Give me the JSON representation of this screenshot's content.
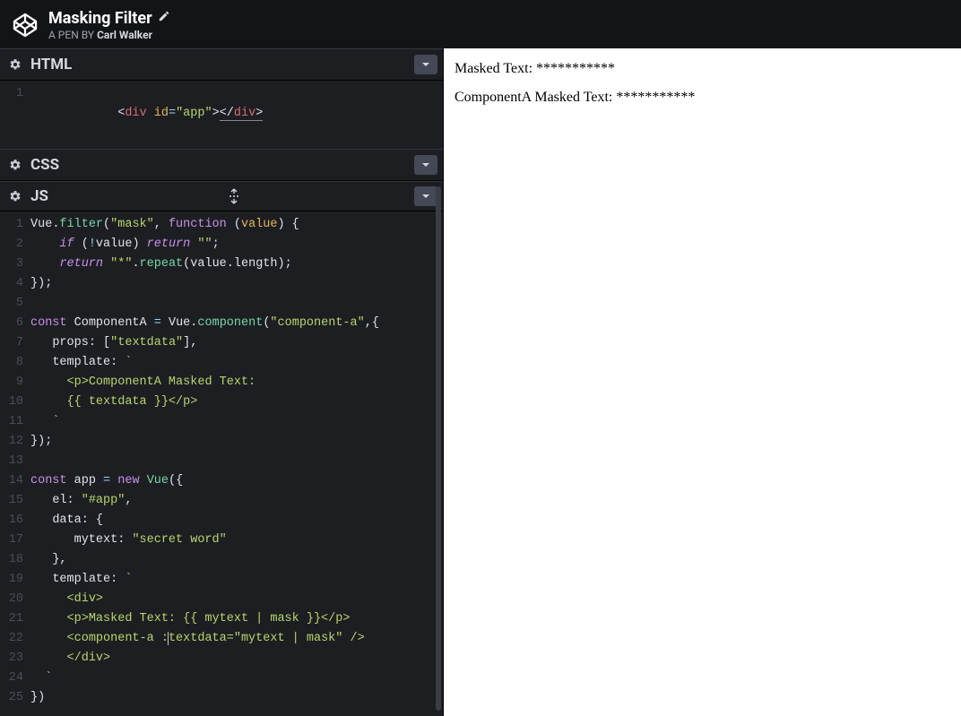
{
  "header": {
    "title": "Masking Filter",
    "byline_prefix": "A PEN BY ",
    "author": "Carl Walker"
  },
  "panels": {
    "html": {
      "label": "HTML"
    },
    "css": {
      "label": "CSS"
    },
    "js": {
      "label": "JS"
    }
  },
  "icons": {
    "gear": "gear-icon",
    "chevron": "chevron-down-icon",
    "resize": "resize-vertical-icon",
    "pencil": "pencil-icon",
    "logo": "codepen-logo"
  },
  "html_code": {
    "l1": {
      "num": "1",
      "a": "<",
      "tag": "div",
      "sp": " ",
      "attr": "id",
      "eq": "=",
      "val": "\"app\"",
      "b": ">",
      "c": "<",
      "slash": "/",
      "tag2": "div",
      "d": ">"
    }
  },
  "js_code": {
    "l1": {
      "num": "1",
      "obj": "Vue",
      "dot": ".",
      "fn": "filter",
      "op": "(",
      "s1": "\"mask\"",
      "c": ", ",
      "kw": "function",
      "sp": " (",
      "arg": "value",
      "cp": ") {"
    },
    "l2": {
      "num": "2",
      "pad": "    ",
      "kw": "if",
      "sp": " (",
      "op": "!",
      "v": "value",
      "cp": ") ",
      "ret": "return",
      "sp2": " ",
      "s": "\"\"",
      "semi": ";"
    },
    "l3": {
      "num": "3",
      "pad": "    ",
      "ret": "return",
      "sp": " ",
      "s": "\"*\"",
      "dot": ".",
      "fn": "repeat",
      "op": "(",
      "v": "value",
      "dot2": ".",
      "prop": "length",
      "cp": ")",
      ";": ";"
    },
    "l4": {
      "num": "4",
      "txt": "});"
    },
    "l5": {
      "num": "5",
      "txt": ""
    },
    "l6": {
      "num": "6",
      "kw": "const",
      "sp": " ",
      "v": "ComponentA",
      "sp2": " ",
      "eq": "=",
      "sp3": " ",
      "obj": "Vue",
      "dot": ".",
      "fn": "component",
      "op": "(",
      "s": "\"component-a\"",
      "c": ",{"
    },
    "l7": {
      "num": "7",
      "pad": "   ",
      "k": "props",
      "c": ": [",
      "s": "\"textdata\"",
      "e": "],"
    },
    "l8": {
      "num": "8",
      "pad": "   ",
      "k": "template",
      "c": ": ",
      "bt": "`"
    },
    "l9": {
      "num": "9",
      "pad": "     ",
      "txt": "<p>ComponentA Masked Text: "
    },
    "l10": {
      "num": "10",
      "pad": "     ",
      "txt": "{{ textdata }}</p>"
    },
    "l11": {
      "num": "11",
      "pad": "   ",
      "bt": "`"
    },
    "l12": {
      "num": "12",
      "txt": "});"
    },
    "l13": {
      "num": "13",
      "txt": ""
    },
    "l14": {
      "num": "14",
      "kw": "const",
      "sp": " ",
      "v": "app",
      "sp2": " ",
      "eq": "=",
      "sp3": " ",
      "kw2": "new",
      "sp4": " ",
      "cls": "Vue",
      "op": "({"
    },
    "l15": {
      "num": "15",
      "pad": "   ",
      "k": "el",
      "c": ": ",
      "s": "\"#app\"",
      "e": ","
    },
    "l16": {
      "num": "16",
      "pad": "   ",
      "k": "data",
      "c": ": {"
    },
    "l17": {
      "num": "17",
      "pad": "      ",
      "k": "mytext",
      "c": ": ",
      "s": "\"secret word\""
    },
    "l18": {
      "num": "18",
      "pad": "   ",
      "txt": "},"
    },
    "l19": {
      "num": "19",
      "pad": "   ",
      "k": "template",
      "c": ": ",
      "bt": "`"
    },
    "l20": {
      "num": "20",
      "pad": "     ",
      "txt": "<div>"
    },
    "l21": {
      "num": "21",
      "pad": "     ",
      "txt": "<p>Masked Text: {{ mytext | mask }}</p>"
    },
    "l22": {
      "num": "22",
      "pad": "     ",
      "a": "<component-a :",
      "b": "textdata=\"mytext | mask\" />"
    },
    "l23": {
      "num": "23",
      "pad": "     ",
      "txt": "</div>"
    },
    "l24": {
      "num": "24",
      "pad": "  ",
      "bt": "`"
    },
    "l25": {
      "num": "25",
      "txt": "})"
    }
  },
  "preview": {
    "line1": "Masked Text: ***********",
    "line2": "ComponentA Masked Text: ***********"
  }
}
